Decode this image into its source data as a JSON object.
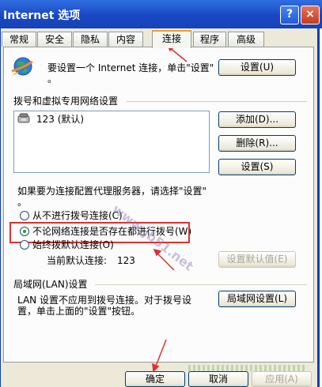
{
  "window": {
    "title": "Internet 选项",
    "help_glyph": "?",
    "close_glyph": "×"
  },
  "tabs": [
    {
      "label": "常规",
      "active": false
    },
    {
      "label": "安全",
      "active": false
    },
    {
      "label": "隐私",
      "active": false
    },
    {
      "label": "内容",
      "active": false
    },
    {
      "label": "连接",
      "active": true
    },
    {
      "label": "程序",
      "active": false
    },
    {
      "label": "高级",
      "active": false
    }
  ],
  "setup": {
    "text_line1": "要设置一个 Internet 连接，单击\"设置\"",
    "text_line2": "。",
    "button": "设置(U)",
    "button_key": "U",
    "icon": "globe-icon"
  },
  "dialup": {
    "heading": "拨号和虚拟专用网络设置",
    "list_items": [
      {
        "label": "123 (默认)",
        "icon": "phone-connection-icon"
      }
    ],
    "add_button": "添加(D)...",
    "remove_button": "删除(R)...",
    "settings_button": "设置(S)"
  },
  "proxy_note": {
    "line1": "如果要为连接配置代理服务器，请选择\"设置\"",
    "line2": "。"
  },
  "options": [
    {
      "label": "从不进行拨号连接(C)",
      "selected": false
    },
    {
      "label": "不论网络连接是否存在都进行拨号(W)",
      "selected": true
    },
    {
      "label": "始终拨默认连接(O)",
      "selected": false
    }
  ],
  "current_default": {
    "label": "当前默认连接:",
    "value": "123"
  },
  "set_default_button": "设置默认值(E)",
  "lan": {
    "heading": "局域网(LAN)设置",
    "text_line1": "LAN 设置不应用到拨号连接。对于拨号设",
    "text_line2": "置，单击上面的\"设置\"按钮。",
    "button": "局域网设置(L)"
  },
  "footer": {
    "ok": "确定",
    "cancel": "取消",
    "apply": "应用(A)"
  },
  "watermark": "www.jb51.net",
  "colors": {
    "titlebar": "#1f52cc",
    "annotation": "#e03030",
    "selected_radio": "#21a121"
  }
}
